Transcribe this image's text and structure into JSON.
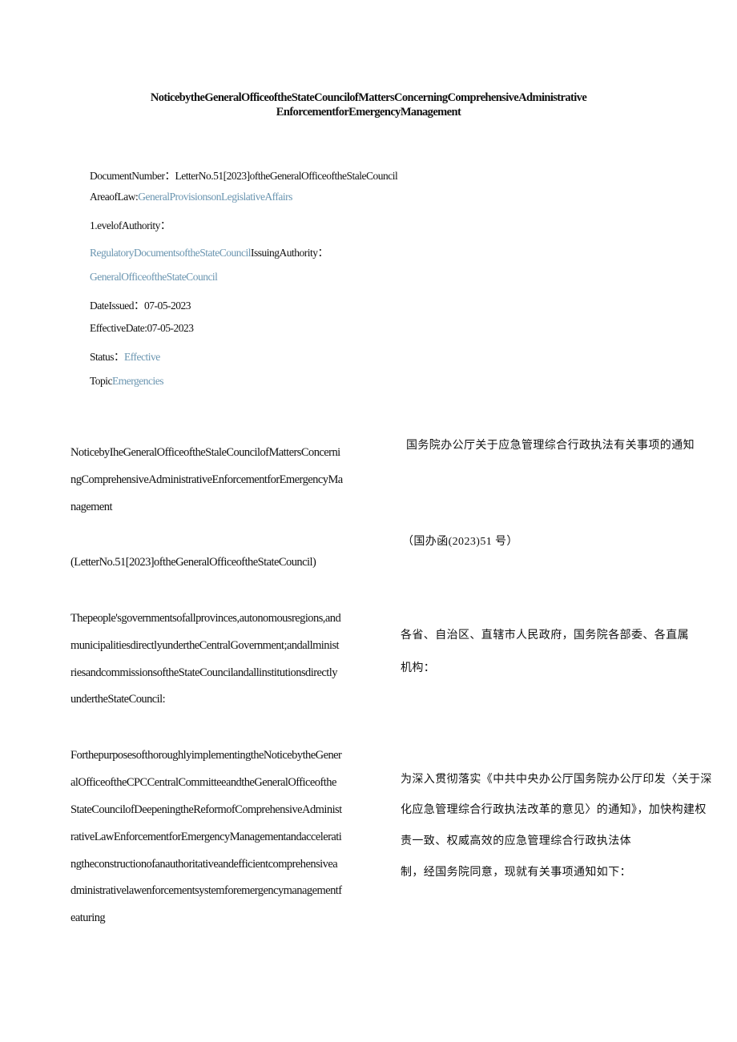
{
  "document": {
    "title_line1": "NoticebytheGeneralOfficeoftheStateCouncilofMattersConcerningComprehensiveAdministrative",
    "title_line2": "EnforcementforEmergencyManagement"
  },
  "meta": {
    "document_number_label": "DocumentNumber：",
    "document_number_value": "LetterNo.51[2023]oftheGeneralOfficeoftheStaleCouncil",
    "area_of_law_label": "AreaofLaw:",
    "area_of_law_value": "GeneralProvisionsonLegislativeAffairs",
    "level_of_authority_label": "1.evelofAuthority：",
    "level_of_authority_value": "RegulatoryDocumentsoftheStateCouncil",
    "issuing_authority_label": "IssuingAuthority：",
    "issuing_authority_value": "GeneralOfficeoftheStateCouncil",
    "date_issued_label": "DateIssued：",
    "date_issued_value": "07-05-2023",
    "effective_date_label": "EffectiveDate:",
    "effective_date_value": "07-05-2023",
    "status_label": "Status：",
    "status_value": "Effective",
    "topic_label": "Topic",
    "topic_value": "Emergencies"
  },
  "colors": {
    "link": "#6a95b0",
    "text": "#111111"
  },
  "english": {
    "title_lines": [
      "NoticebyIheGeneralOfficeoftheStaleCouncilofMattersConcerni",
      "ngComprehensiveAdministrativeEnforcementforEmergencyMa",
      "nagement"
    ],
    "letter_no": "(LetterNo.51[2023]oftheGeneralOfficeoftheStateCouncil)",
    "addressee_lines": [
      "Thepeople'sgovernmentsofallprovinces,autonomousregions,and",
      "municipalitiesdirectlyundertheCentralGovernment;andallminist",
      "riesandcommissionsoftheStateCouncilandallinstitutionsdirectly",
      "undertheStateCouncil:"
    ],
    "body_lines": [
      "ForthepurposesofthoroughlyimplementingtheNoticebytheGener",
      "alOfficeoftheCPCCentralCommitteeandtheGeneralOfficeofthe",
      "StateCouncilofDeepeningtheReformofComprehensiveAdminist",
      "rativeLawEnforcementforEmergencyManagementandaccelerati",
      "ngtheconstructionofanauthoritativeandefficientcomprehensivea",
      "dministrativelawenforcementsystemforemergencymanagementf",
      "eaturing"
    ]
  },
  "chinese": {
    "title": "国务院办公厅关于应急管理综合行政执法有关事项的通知",
    "letter_no": "（国办函(2023)51 号）",
    "addressee_lines": [
      "各省、自治区、直辖市人民政府，国务院各部委、各直属",
      "机构："
    ],
    "body_lines": [
      "为深入贯彻落实《中共中央办公厅国务院办公厅印发〈关于深",
      "化应急管理综合行政执法改革的意见〉的通知》，加快构建权",
      "责一致、权威高效的应急管理综合行政执法体",
      "制，经国务院同意，现就有关事项通知如下："
    ]
  }
}
